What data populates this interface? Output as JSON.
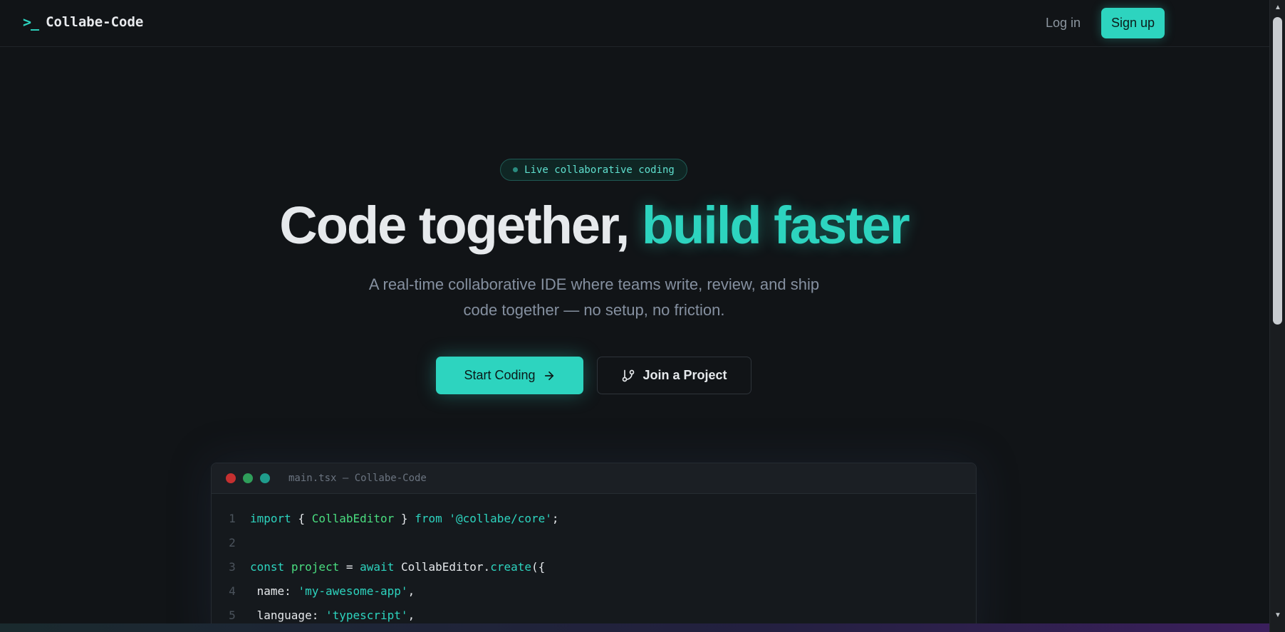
{
  "nav": {
    "brand_icon": ">_",
    "brand_name": "Collabe-Code",
    "login_label": "Log in",
    "signup_label": "Sign up"
  },
  "hero": {
    "badge_text": "Live collaborative coding",
    "headline_main": "Code together, ",
    "headline_accent": "build faster",
    "subtitle_line1": "A real-time collaborative IDE where teams write, review, and ship",
    "subtitle_line2": "code together — no setup, no friction.",
    "primary_label": "Start Coding",
    "primary_icon": "arrow-right-icon",
    "secondary_label": "Join a Project",
    "secondary_icon": "git-branch-icon"
  },
  "editor": {
    "title": "main.tsx — Collabe-Code",
    "lines": [
      {
        "n": "1",
        "parts": [
          "import",
          " { ",
          "CollabEditor",
          " } ",
          "from",
          " ",
          "'@collabe/core'",
          ";"
        ]
      },
      {
        "n": "2",
        "parts": []
      },
      {
        "n": "3",
        "parts": [
          "const",
          " ",
          "project",
          " = ",
          "await",
          " CollabEditor.",
          "create",
          "({"
        ]
      },
      {
        "n": "4",
        "parts": [
          " name: ",
          "'my-awesome-app'",
          ","
        ]
      },
      {
        "n": "5",
        "parts": [
          " language: ",
          "'typescript'",
          ","
        ]
      }
    ]
  },
  "colors": {
    "accent": "#2dd4bf",
    "background": "#111417",
    "function": "#4ade80"
  }
}
